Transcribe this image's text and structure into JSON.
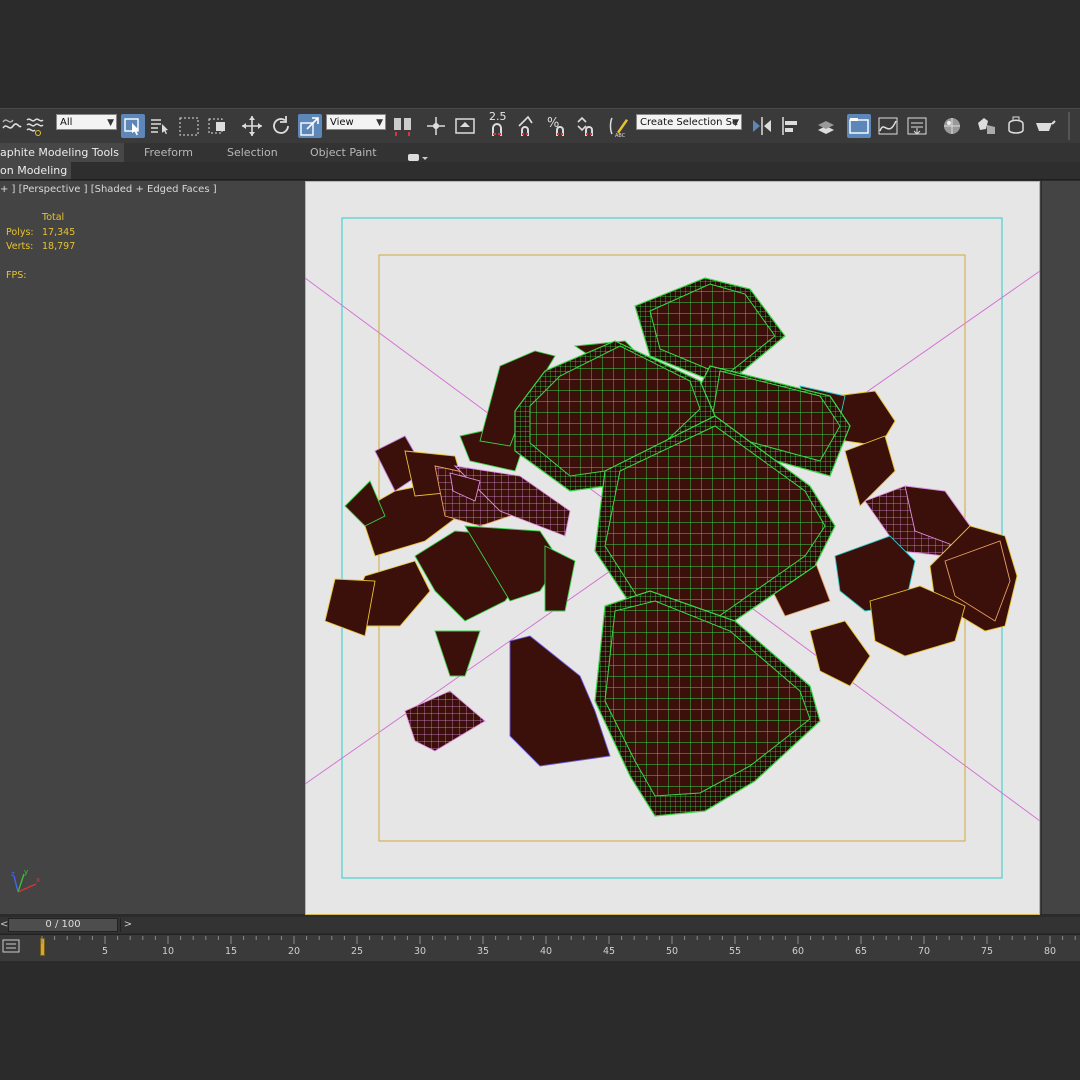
{
  "toolbar": {
    "filter_dropdown": "All",
    "coord_dropdown": "View",
    "snap_value": "2.5",
    "named_selection": "Create Selection Se"
  },
  "ribbon": {
    "tabs": [
      "aphite Modeling Tools",
      "Freeform",
      "Selection",
      "Object Paint"
    ],
    "subtab": "on Modeling"
  },
  "viewport": {
    "label": "+ ] [Perspective ] [Shaded + Edged Faces ]",
    "stats": {
      "header": "Total",
      "polys_label": "Polys:",
      "polys_value": "17,345",
      "verts_label": "Verts:",
      "verts_value": "18,797",
      "fps_label": "FPS:"
    },
    "axis_labels": {
      "x": "x",
      "y": "y",
      "z": "z"
    }
  },
  "timeline": {
    "slider_text": "0 / 100",
    "next_arrow": ">",
    "prev_arrow": "<",
    "frame_position": 0,
    "frame_total": 100,
    "ticks": [
      "5",
      "10",
      "15",
      "20",
      "25",
      "30",
      "35",
      "40",
      "45",
      "50",
      "55",
      "60",
      "65",
      "70",
      "75",
      "80"
    ]
  },
  "colors": {
    "wire_green": "#39d84a",
    "chocolate": "#3b0f0a",
    "safe_frame_yellow": "#d2a83a",
    "safe_frame_cyan": "#2fc9c9",
    "active_blue": "#5d87b8",
    "stat_yellow": "#e6c230"
  }
}
